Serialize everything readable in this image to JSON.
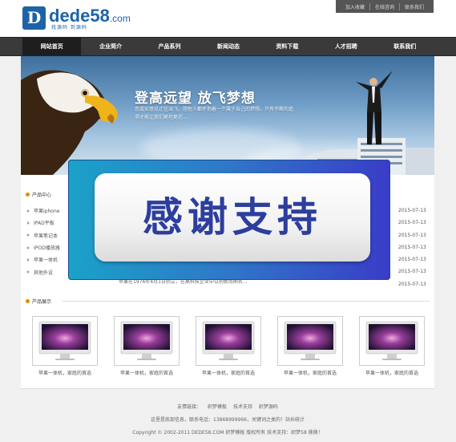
{
  "header": {
    "logo_mark": "D",
    "logo_text": "dede58",
    "logo_suffix": ".com",
    "logo_tagline": "找源码 到源码",
    "top_links": [
      "加入收藏",
      "在线咨询",
      "联系我们"
    ]
  },
  "nav": {
    "items": [
      "网站首页",
      "企业简介",
      "产品系列",
      "新闻动态",
      "资料下载",
      "人才招聘",
      "联系我们"
    ],
    "active_index": 0
  },
  "banner": {
    "slogan": "登高远望 放飞梦想",
    "subtext": "您或安意见迁往当飞，胆佐人都怀抱着一个属于自己的梦想，只有不断的追求才能让我们更坦更近..."
  },
  "products": {
    "title": "产品中心",
    "items": [
      "苹果iphone",
      "IPAD平板",
      "苹果笔记本",
      "IPOD播放器",
      "苹果一体机",
      "其他外设"
    ]
  },
  "news": {
    "dates": [
      "2015-07-13",
      "2015-07-13",
      "2015-07-13",
      "2015-07-13",
      "2015-07-13",
      "2015-07-13",
      "2015-07-13"
    ]
  },
  "about": {
    "snippet": "苹果在1976年4月1日创立，在高科技企业中以创新而闻名..."
  },
  "overlay": {
    "text": "感谢支持"
  },
  "showcase": {
    "title": "产品展示",
    "items": [
      {
        "caption": "苹果一体机，家庭的首选"
      },
      {
        "caption": "苹果一体机，家庭的首选"
      },
      {
        "caption": "苹果一体机，家庭的首选"
      },
      {
        "caption": "苹果一体机，家庭的首选"
      },
      {
        "caption": "苹果一体机，家庭的首选"
      }
    ]
  },
  "footer": {
    "links_label": "友情链接：",
    "links": [
      "织梦模板",
      "技术支持",
      "织梦源码"
    ],
    "contact": "这里是底部信息，联系电话：13868999966，关键词之类的！站长统计",
    "copyright": "Copyright © 2002-2011 DEDE58.COM 织梦模板 版权所有  技术支持：织梦58  鼎鼎！"
  },
  "colors": {
    "brand": "#1c63a8",
    "nav_bg": "#3a3a3a",
    "accent_dot": "#e08a00",
    "overlay_text": "#2c3e9e"
  }
}
